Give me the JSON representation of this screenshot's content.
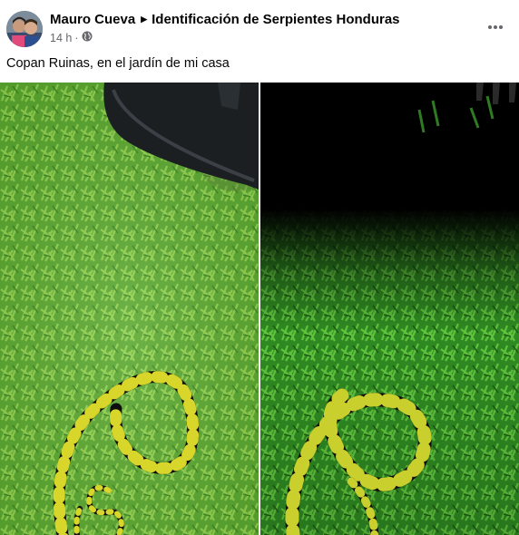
{
  "post": {
    "author_name": "Mauro Cueva",
    "group_name": "Identificación de Serpientes Honduras",
    "timestamp": "14 h",
    "separator": "·",
    "privacy_icon": "globe-icon",
    "more_icon": "more-options-icon",
    "caption": "Copan Ruinas, en el jardín de mi casa",
    "photos": [
      {
        "subject": "snake-on-grass-daylight"
      },
      {
        "subject": "snake-on-grass-night-flash"
      }
    ]
  },
  "colors": {
    "text_primary": "#050505",
    "text_secondary": "#65676b",
    "grass_light": "#6dba3a",
    "grass_night": "#3d9a2c",
    "snake_band": "#d8d62a",
    "snake_body": "#0d0d0d"
  }
}
